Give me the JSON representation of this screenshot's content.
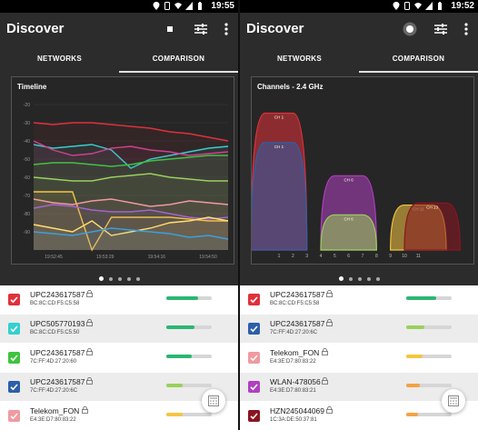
{
  "left": {
    "status_time": "19:55",
    "app_title": "Discover",
    "tabs": [
      "NETWORKS",
      "COMPARISON"
    ],
    "active_tab": "COMPARISON",
    "rows": [
      {
        "ssid": "UPC243617587",
        "mac": "BC:8C:CD:F5:C5:58",
        "checkbox_color": "#e0313b",
        "signal": 0.7,
        "bar_color": "#2bb673",
        "alt": false
      },
      {
        "ssid": "UPC505770193",
        "mac": "BC:8C:CD:F5:C5:50",
        "checkbox_color": "#33d0d0",
        "signal": 0.62,
        "bar_color": "#2bb673",
        "alt": true
      },
      {
        "ssid": "UPC243617587",
        "mac": "7C:FF:4D:27:20:60",
        "checkbox_color": "#3ec43e",
        "signal": 0.55,
        "bar_color": "#2bb673",
        "alt": false
      },
      {
        "ssid": "UPC243617587",
        "mac": "7C:FF:4D:27:20:6C",
        "checkbox_color": "#2d5fa8",
        "signal": 0.35,
        "bar_color": "#9ad15a",
        "alt": true
      },
      {
        "ssid": "Telekom_FON",
        "mac": "E4:3E:D7:80:83:22",
        "checkbox_color": "#f09aa0",
        "signal": 0.35,
        "bar_color": "#f5c542",
        "alt": false
      }
    ],
    "chart_data": {
      "type": "line",
      "title": "Timeline",
      "xlabel": "",
      "ylabel": "",
      "x": [
        "19:52:45",
        "19:53:29",
        "19:54:16",
        "19:54:50"
      ],
      "yticks": [
        -20,
        -30,
        -40,
        -50,
        -60,
        -70,
        -80,
        -90
      ],
      "ylim": [
        -100,
        -15
      ],
      "series": [
        {
          "color": "#e0313b",
          "values": [
            -30,
            -31,
            -30,
            -30,
            -31,
            -32,
            -33,
            -35,
            -36,
            -38,
            -40
          ]
        },
        {
          "color": "#33d0d0",
          "values": [
            -42,
            -44,
            -43,
            -42,
            -45,
            -55,
            -50,
            -48,
            -46,
            -44,
            -43
          ]
        },
        {
          "color": "#d04090",
          "values": [
            -40,
            -45,
            -48,
            -47,
            -44,
            -43,
            -45,
            -46,
            -48,
            -47,
            -46
          ]
        },
        {
          "color": "#3ec43e",
          "values": [
            -53,
            -52,
            -52,
            -53,
            -54,
            -53,
            -51,
            -50,
            -49,
            -48,
            -48
          ]
        },
        {
          "color": "#9ad15a",
          "values": [
            -60,
            -61,
            -62,
            -62,
            -60,
            -59,
            -58,
            -60,
            -61,
            -62,
            -62
          ]
        },
        {
          "color": "#f5c542",
          "values": [
            -68,
            -68,
            -68,
            -100,
            -82,
            -82,
            -82,
            -82,
            -83,
            -84,
            -84
          ]
        },
        {
          "color": "#a060d0",
          "values": [
            -77,
            -75,
            -76,
            -78,
            -79,
            -79,
            -78,
            -80,
            -82,
            -83,
            -82
          ]
        },
        {
          "color": "#f09aa0",
          "values": [
            -72,
            -74,
            -75,
            -73,
            -72,
            -74,
            -76,
            -75,
            -73,
            -74,
            -75
          ]
        },
        {
          "color": "#ffe070",
          "values": [
            -86,
            -88,
            -90,
            -84,
            -92,
            -90,
            -88,
            -85,
            -84,
            -82,
            -84
          ]
        },
        {
          "color": "#3aa0e0",
          "values": [
            -90,
            -91,
            -92,
            -90,
            -88,
            -89,
            -90,
            -91,
            -93,
            -92,
            -94
          ]
        }
      ]
    }
  },
  "right": {
    "status_time": "19:52",
    "app_title": "Discover",
    "tabs": [
      "NETWORKS",
      "COMPARISON"
    ],
    "active_tab": "COMPARISON",
    "rows": [
      {
        "ssid": "UPC243617587",
        "mac": "BC:8C:CD:F5:C5:58",
        "checkbox_color": "#e0313b",
        "signal": 0.65,
        "bar_color": "#2bb673",
        "alt": false
      },
      {
        "ssid": "UPC243617587",
        "mac": "7C:FF:4D:27:20:6C",
        "checkbox_color": "#2d5fa8",
        "signal": 0.4,
        "bar_color": "#9ad15a",
        "alt": true
      },
      {
        "ssid": "Telekom_FON",
        "mac": "E4:3E:D7:80:83:22",
        "checkbox_color": "#f09aa0",
        "signal": 0.35,
        "bar_color": "#f5c542",
        "alt": false
      },
      {
        "ssid": "WLAN-478056",
        "mac": "E4:3E:D7:80:83:21",
        "checkbox_color": "#b040c0",
        "signal": 0.3,
        "bar_color": "#f5a142",
        "alt": true
      },
      {
        "ssid": "HZN245044069",
        "mac": "1C:3A:DE:50:37:81",
        "checkbox_color": "#8a1520",
        "signal": 0.25,
        "bar_color": "#f5a142",
        "alt": false
      }
    ],
    "chart_data": {
      "type": "area",
      "title": "Channels - 2.4 GHz",
      "xlabel": "",
      "ylabel": "",
      "categories": [
        "1",
        "2",
        "3",
        "4",
        "5",
        "6",
        "7",
        "8",
        "9",
        "10",
        "11"
      ],
      "ylim": [
        -100,
        -20
      ],
      "series": [
        {
          "label": "CH 1",
          "channel": 1,
          "value": -30,
          "color": "#e0313b"
        },
        {
          "label": "CH 1",
          "channel": 1,
          "value": -45,
          "color": "#2d5fa8"
        },
        {
          "label": "CH 6",
          "channel": 6,
          "value": -62,
          "color": "#b040c0"
        },
        {
          "label": "CH 6",
          "channel": 6,
          "value": -82,
          "color": "#9ad15a"
        },
        {
          "label": "CH 11",
          "channel": 11,
          "value": -77,
          "color": "#f5c542"
        },
        {
          "label": "CH 13",
          "channel": 12,
          "value": -76,
          "color": "#8a1520"
        }
      ]
    }
  },
  "pager": {
    "count": 5,
    "active": 0
  }
}
